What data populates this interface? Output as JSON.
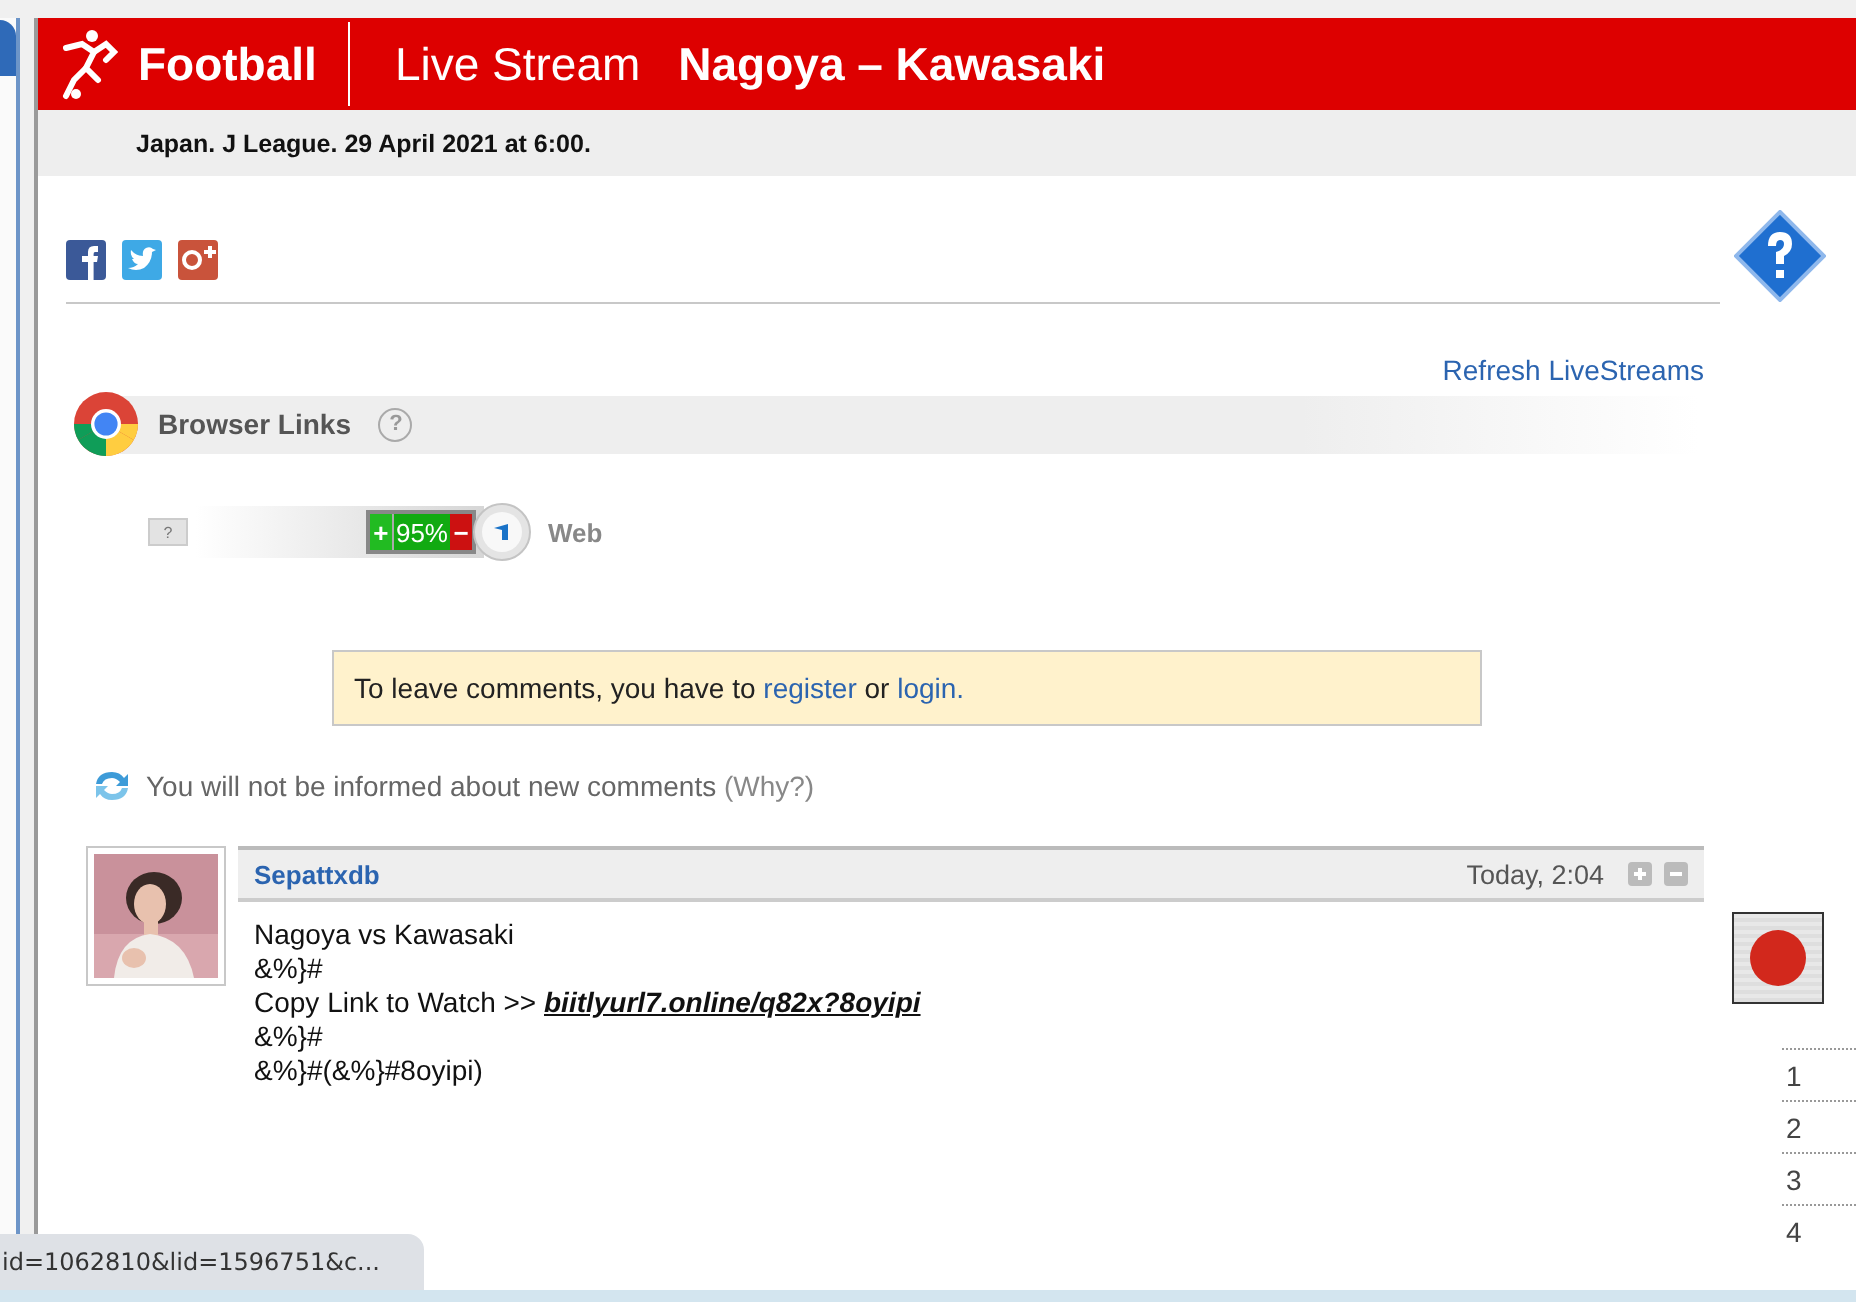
{
  "header": {
    "sport": "Football",
    "section": "Live Stream",
    "match": "Nagoya – Kawasaki"
  },
  "subheader": "Japan. J League. 29 April 2021 at 6:00.",
  "share_icons": [
    {
      "kind": "facebook"
    },
    {
      "kind": "twitter"
    },
    {
      "kind": "googleplus"
    }
  ],
  "refresh_link": "Refresh LiveStreams",
  "browser_links": {
    "title": "Browser Links",
    "help": "?"
  },
  "stream": {
    "help": "?",
    "plus": "+",
    "rating": "95%",
    "minus": "−",
    "label": "Web"
  },
  "notice": {
    "before": "To leave comments, you have to ",
    "register": "register",
    "middle": " or ",
    "login": "login."
  },
  "notify": {
    "text": "You will not be informed about new comments",
    "why": "(Why?)"
  },
  "comment": {
    "author": "Sepattxdb",
    "time": "Today, 2:04",
    "lines": [
      {
        "text": "Nagoya vs Kawasaki"
      },
      {
        "text": "&%}#"
      },
      {
        "text": "Copy Link to Watch >> ",
        "link": "biitlyurl7.online/q82x?8oyipi"
      },
      {
        "text": "&%}#"
      },
      {
        "text": "&%}#(&%}#8oyipi)"
      }
    ]
  },
  "side_list": [
    "1",
    "2",
    "3",
    "4"
  ],
  "status_url": "id=1062810&lid=1596751&c..."
}
